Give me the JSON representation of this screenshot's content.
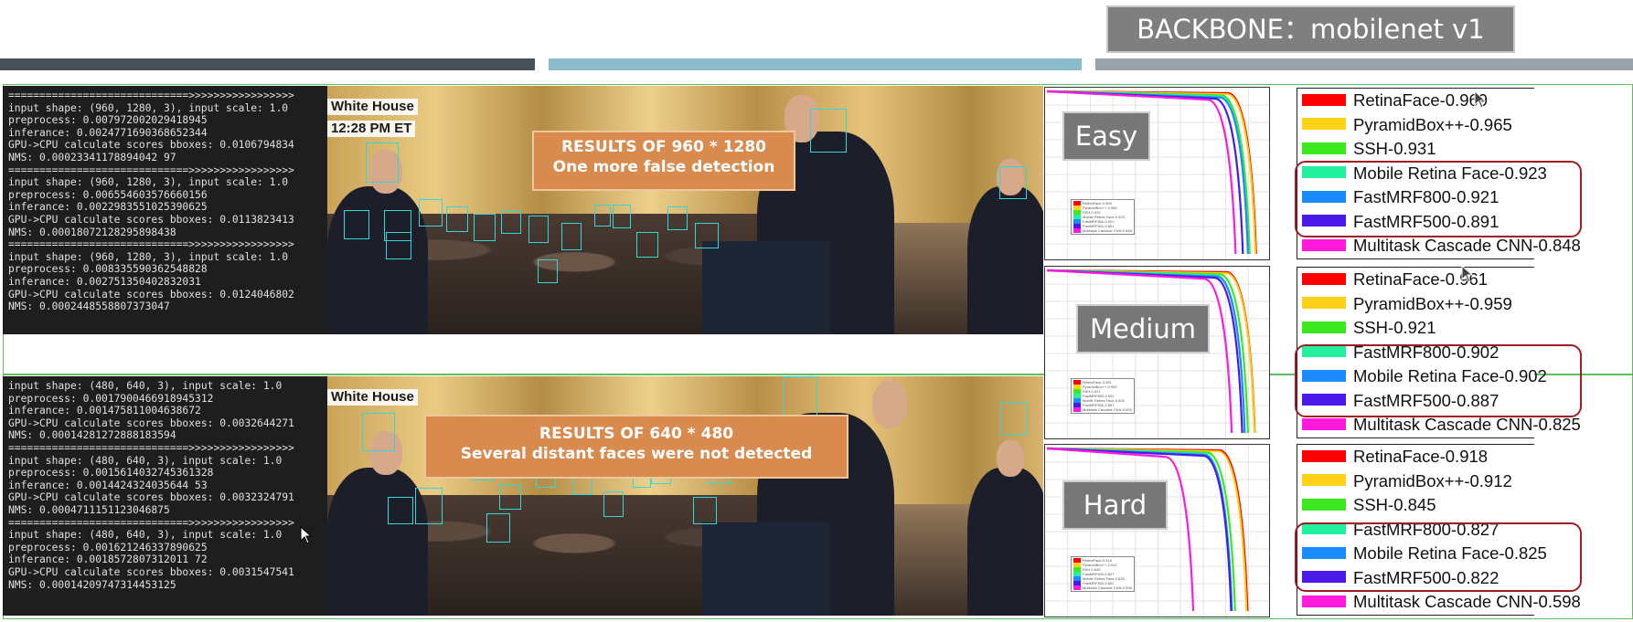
{
  "header": {
    "backbone_title": "BACKBONE：mobilenet v1",
    "bar_colors": [
      "#48525b",
      "#8bbccc",
      "#9aa3a9"
    ]
  },
  "top_panel": {
    "terminal_lines": [
      "=============================>>>>>>>>>>>>>>>>>",
      "input shape: (960, 1280, 3), input scale: 1.0",
      "preprocess: 0.007972002029418945",
      "inferance: 0.0024771690368652344",
      "GPU->CPU calculate scores bboxes: 0.0106794834",
      "NMS: 0.00023341178894042 97",
      "=============================>>>>>>>>>>>>>>>>>",
      "input shape: (960, 1280, 3), input scale: 1.0",
      "preprocess: 0.006554603576660156",
      "inferance: 0.0022983551025390625",
      "GPU->CPU calculate scores bboxes: 0.0113823413",
      "NMS: 0.00018072128295898438",
      "=============================>>>>>>>>>>>>>>>>>",
      "input shape: (960, 1280, 3), input scale: 1.0",
      "preprocess: 0.008335590362548828",
      "inferance: 0.002751350402832031",
      "GPU->CPU calculate scores bboxes: 0.0124046802",
      "NMS: 0.0002448558807373047"
    ],
    "caption_line1": "White House",
    "caption_line2": "12:28 PM ET",
    "result_title": "RESULTS OF 960 * 1280",
    "result_subtitle": "One more false detection"
  },
  "bottom_panel": {
    "terminal_lines": [
      "input shape: (480, 640, 3), input scale: 1.0",
      "preprocess: 0.0017900466918945312",
      "inferance: 0.001475811004638672",
      "GPU->CPU calculate scores bboxes: 0.0032644271",
      "NMS: 0.00014281272888183594",
      "=============================>>>>>>>>>>>>>>>>>",
      "input shape: (480, 640, 3), input scale: 1.0",
      "preprocess: 0.0015614032745361328",
      "inferance: 0.0014424324035644 53",
      "GPU->CPU calculate scores bboxes: 0.0032324791",
      "NMS: 0.0004711151123046875",
      "=============================>>>>>>>>>>>>>>>>>",
      "input shape: (480, 640, 3), input scale: 1.0",
      "preprocess: 0.001621246337890625",
      "inferance: 0.0018572807312011 72",
      "GPU->CPU calculate scores bboxes: 0.0031547541",
      "NMS: 0.00014209747314453125"
    ],
    "caption_line1": "White House",
    "result_title": "RESULTS OF 640 * 480",
    "result_subtitle": "Several distant faces were not detected"
  },
  "charts": [
    {
      "label": "Easy",
      "legend": [
        {
          "name": "RetinaFace-0.969",
          "color": "#ff0000"
        },
        {
          "name": "PyramidBox++-0.965",
          "color": "#ffd21a"
        },
        {
          "name": "SSH-0.931",
          "color": "#3ee820"
        },
        {
          "name": "Mobile Retina Face-0.923",
          "color": "#24f0a0"
        },
        {
          "name": "FastMRF800-0.921",
          "color": "#1a8cff"
        },
        {
          "name": "FastMRF500-0.891",
          "color": "#4a1ae8"
        },
        {
          "name": "Multitask Cascade CNN-0.848",
          "color": "#ff1adc"
        }
      ]
    },
    {
      "label": "Medium",
      "legend": [
        {
          "name": "RetinaFace-0.961",
          "color": "#ff0000"
        },
        {
          "name": "PyramidBox++-0.959",
          "color": "#ffd21a"
        },
        {
          "name": "SSH-0.921",
          "color": "#3ee820"
        },
        {
          "name": "FastMRF800-0.902",
          "color": "#24f0a0"
        },
        {
          "name": "Mobile Retina Face-0.902",
          "color": "#1a8cff"
        },
        {
          "name": "FastMRF500-0.887",
          "color": "#4a1ae8"
        },
        {
          "name": "Multitask Cascade CNN-0.825",
          "color": "#ff1adc"
        }
      ]
    },
    {
      "label": "Hard",
      "legend": [
        {
          "name": "RetinaFace-0.918",
          "color": "#ff0000"
        },
        {
          "name": "PyramidBox++-0.912",
          "color": "#ffd21a"
        },
        {
          "name": "SSH-0.845",
          "color": "#3ee820"
        },
        {
          "name": "FastMRF800-0.827",
          "color": "#24f0a0"
        },
        {
          "name": "Mobile Retina Face-0.825",
          "color": "#1a8cff"
        },
        {
          "name": "FastMRF500-0.822",
          "color": "#4a1ae8"
        },
        {
          "name": "Multitask Cascade CNN-0.598",
          "color": "#ff1adc"
        }
      ]
    }
  ],
  "colors": {
    "result_box": "#d98a4f",
    "highlight_border": "#a01c22",
    "face_box": "#34d6d6",
    "label_box": "#777777"
  }
}
